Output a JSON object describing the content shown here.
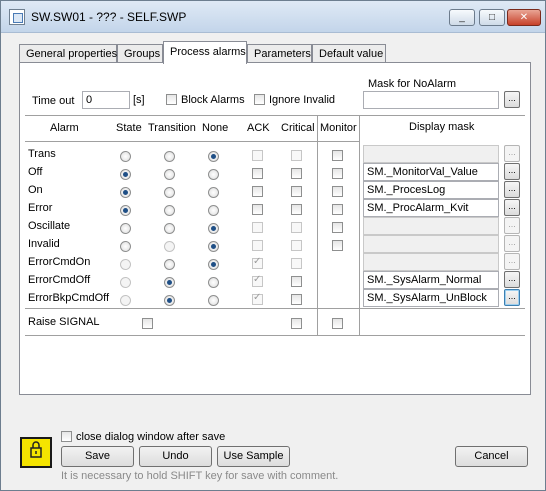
{
  "window": {
    "title": "SW.SW01 - ??? - SELF.SWP",
    "min": "_",
    "max": "□",
    "close": "✕"
  },
  "tabs": [
    "General properties",
    "Groups",
    "Process alarms",
    "Parameters",
    "Default value"
  ],
  "timeout": {
    "label": "Time out",
    "value": "0",
    "unit": "[s]"
  },
  "block_alarms": "Block Alarms",
  "ignore_invalid": "Ignore Invalid",
  "mask_noalarm": {
    "label": "Mask for NoAlarm",
    "value": ""
  },
  "headers": {
    "alarm": "Alarm",
    "state": "State",
    "transition": "Transition",
    "none": "None",
    "ack": "ACK",
    "critical": "Critical",
    "monitor": "Monitor",
    "display_mask": "Display mask"
  },
  "rows": [
    {
      "name": "Trans",
      "mask": ""
    },
    {
      "name": "Off",
      "mask": "SM._MonitorVal_Value"
    },
    {
      "name": "On",
      "mask": "SM._ProcesLog"
    },
    {
      "name": "Error",
      "mask": "SM._ProcAlarm_Kvit"
    },
    {
      "name": "Oscillate",
      "mask": ""
    },
    {
      "name": "Invalid",
      "mask": ""
    },
    {
      "name": "ErrorCmdOn",
      "mask": ""
    },
    {
      "name": "ErrorCmdOff",
      "mask": "SM._SysAlarm_Normal"
    },
    {
      "name": "ErrorBkpCmdOff",
      "mask": "SM._SysAlarm_UnBlock"
    }
  ],
  "raise_signal": "Raise SIGNAL",
  "footer": {
    "close_after_save": "close dialog window after save",
    "hint": "It is necessary to hold SHIFT key for save with comment.",
    "save": "Save",
    "undo": "Undo",
    "use_sample": "Use Sample",
    "cancel": "Cancel",
    "dots": "..."
  },
  "icons": {
    "app": "app-window-icon",
    "lock": "lock-icon"
  },
  "colors": {
    "lock_bg": "#f5e400",
    "radio_dot": "#1f4f86"
  }
}
